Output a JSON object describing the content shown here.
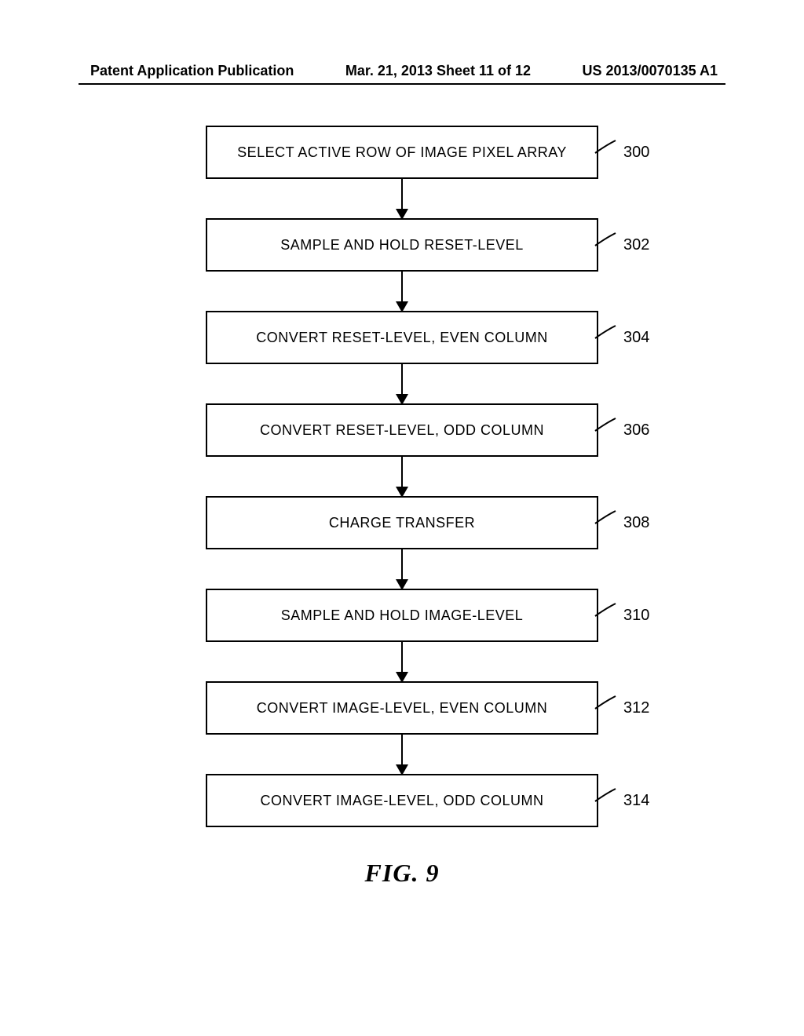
{
  "header": {
    "left": "Patent Application Publication",
    "center": "Mar. 21, 2013  Sheet 11 of 12",
    "right": "US 2013/0070135 A1"
  },
  "chart_data": {
    "type": "flowchart",
    "direction": "top-to-bottom",
    "title": "FIG. 9",
    "nodes": [
      {
        "ref": "300",
        "label": "SELECT ACTIVE ROW OF IMAGE PIXEL ARRAY"
      },
      {
        "ref": "302",
        "label": "SAMPLE AND HOLD RESET-LEVEL"
      },
      {
        "ref": "304",
        "label": "CONVERT RESET-LEVEL, EVEN COLUMN"
      },
      {
        "ref": "306",
        "label": "CONVERT RESET-LEVEL, ODD COLUMN"
      },
      {
        "ref": "308",
        "label": "CHARGE TRANSFER"
      },
      {
        "ref": "310",
        "label": "SAMPLE AND HOLD IMAGE-LEVEL"
      },
      {
        "ref": "312",
        "label": "CONVERT IMAGE-LEVEL, EVEN COLUMN"
      },
      {
        "ref": "314",
        "label": "CONVERT IMAGE-LEVEL, ODD COLUMN"
      }
    ],
    "edges": [
      [
        "300",
        "302"
      ],
      [
        "302",
        "304"
      ],
      [
        "304",
        "306"
      ],
      [
        "306",
        "308"
      ],
      [
        "308",
        "310"
      ],
      [
        "310",
        "312"
      ],
      [
        "312",
        "314"
      ]
    ]
  }
}
